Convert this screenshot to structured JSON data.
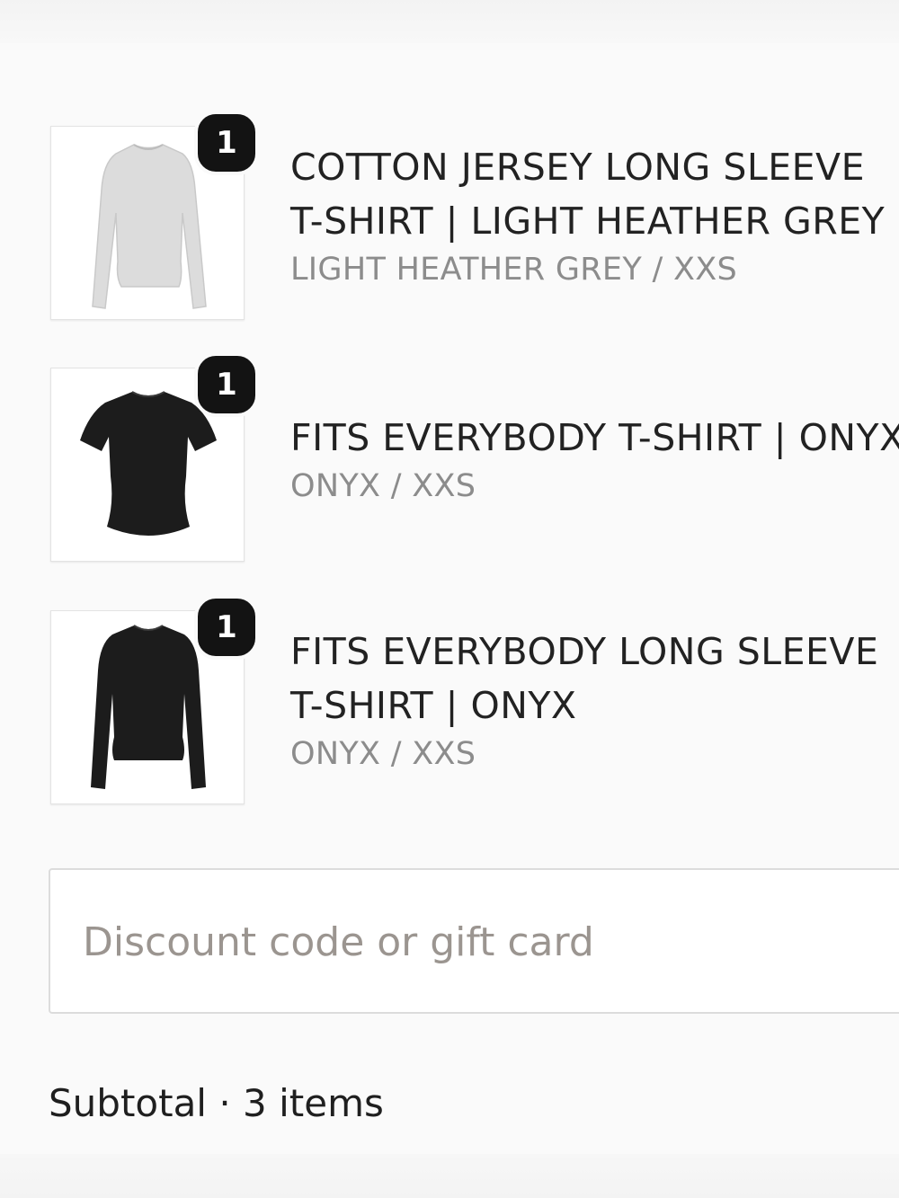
{
  "line_items": [
    {
      "quantity": "1",
      "title_line1": "COTTON JERSEY LONG SLEEVE",
      "title_line2": "T-SHIRT | LIGHT HEATHER GREY",
      "variant": "LIGHT HEATHER GREY / XXS",
      "image_icon": "long-sleeve-shirt-icon",
      "image_color": "#dcdcdc"
    },
    {
      "quantity": "1",
      "title_line1": "FITS EVERYBODY T-SHIRT | ONYX",
      "variant": "ONYX / XXS",
      "image_icon": "t-shirt-icon",
      "image_color": "#1c1c1c"
    },
    {
      "quantity": "1",
      "title_line1": "FITS EVERYBODY LONG SLEEVE",
      "title_line2": "T-SHIRT | ONYX",
      "variant": "ONYX / XXS",
      "image_icon": "long-sleeve-shirt-icon",
      "image_color": "#1c1c1c"
    }
  ],
  "discount": {
    "placeholder": "Discount code or gift card",
    "value": ""
  },
  "summary": {
    "subtotal_label": "Subtotal · 3 items"
  }
}
